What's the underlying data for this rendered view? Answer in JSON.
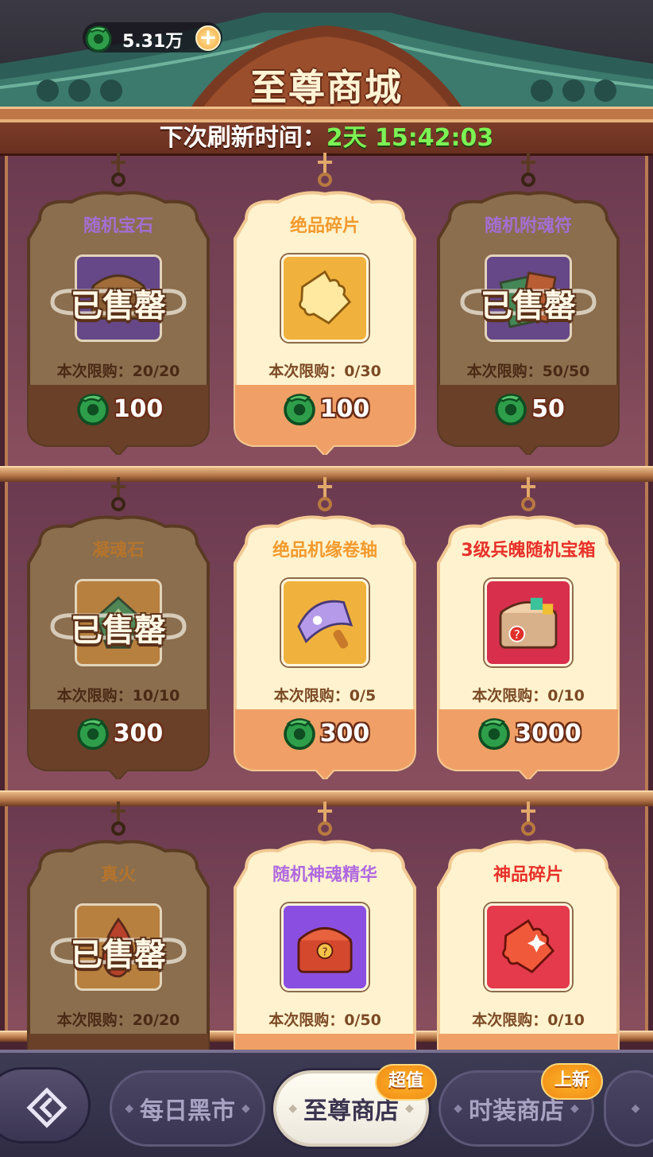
{
  "header": {
    "currency_amount": "5.31万",
    "title": "至尊商城",
    "refresh_label": "下次刷新时间：",
    "refresh_time": "2天 15:42:03"
  },
  "sold_out_label": "已售罄",
  "items": [
    {
      "name": "随机宝石",
      "limit": "本次限购：20/20",
      "price": "100",
      "sold_out": true,
      "name_color": "#a46fd1",
      "icon": "treasure-chest-icon"
    },
    {
      "name": "绝品碎片",
      "limit": "本次限购：0/30",
      "price": "100",
      "sold_out": false,
      "name_color": "#f29a2e",
      "icon": "gold-fragment-icon"
    },
    {
      "name": "随机附魂符",
      "limit": "本次限购：50/50",
      "price": "50",
      "sold_out": true,
      "name_color": "#a46fd1",
      "icon": "talisman-icon"
    },
    {
      "name": "凝魂石",
      "limit": "本次限购：10/10",
      "price": "300",
      "sold_out": true,
      "name_color": "#b5742c",
      "icon": "soul-stone-icon"
    },
    {
      "name": "绝品机缘卷轴",
      "limit": "本次限购：0/5",
      "price": "300",
      "sold_out": false,
      "name_color": "#f29a2e",
      "icon": "scroll-icon"
    },
    {
      "name": "3级兵魄随机宝箱",
      "limit": "本次限购：0/10",
      "price": "3000",
      "sold_out": false,
      "name_color": "#e8312a",
      "icon": "mystery-chest-icon"
    },
    {
      "name": "真火",
      "limit": "本次限购：20/20",
      "price": "",
      "sold_out": true,
      "name_color": "#b5742c",
      "icon": "true-fire-icon"
    },
    {
      "name": "随机神魂精华",
      "limit": "本次限购：0/50",
      "price": "",
      "sold_out": false,
      "name_color": "#b06ae0",
      "icon": "spirit-chest-icon"
    },
    {
      "name": "神品碎片",
      "limit": "本次限购：0/10",
      "price": "",
      "sold_out": false,
      "name_color": "#e8312a",
      "icon": "red-fragment-icon"
    }
  ],
  "tabs": [
    {
      "label": "每日黑市",
      "badge": "",
      "selected": false
    },
    {
      "label": "至尊商店",
      "badge": "超值",
      "selected": true
    },
    {
      "label": "时装商店",
      "badge": "上新",
      "selected": false
    }
  ],
  "colors": {
    "jade": "#2e9e4a",
    "time_green": "#7cf254",
    "card_cream": "#fff3cf",
    "card_price_band": "#f0a066",
    "sold_card": "#8a6e4e"
  }
}
